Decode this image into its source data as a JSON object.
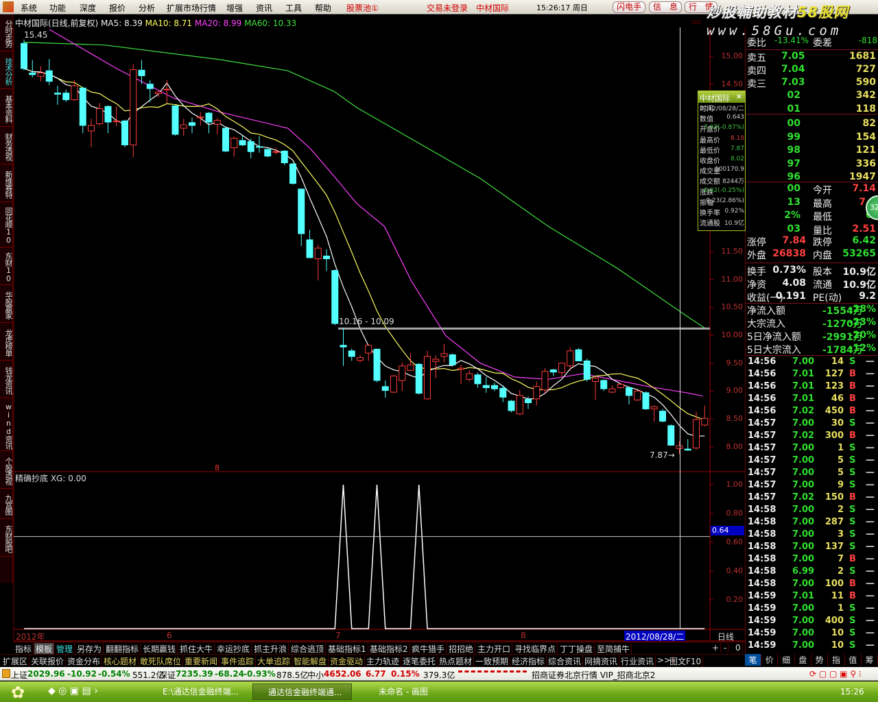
{
  "menu": {
    "items": [
      "系统",
      "功能",
      "深度",
      "报价",
      "分析",
      "扩展市场行情",
      "增强",
      "资讯",
      "工具",
      "帮助"
    ],
    "stock_pool": "股票池①",
    "trade_status": "交易未登录",
    "stock_name": "中材国际",
    "clock": "15:26:17 周日",
    "buttons": [
      "闪电手",
      "信　息",
      "行　情"
    ]
  },
  "watermark": {
    "line1a": "炒股輔助教材",
    "line1b": "58股网",
    "line2": "www.58Gu.com"
  },
  "sidebar": [
    "分时走势",
    "技术分析",
    "基本资料",
    "财务透视",
    "新维赛特",
    "同花顺10",
    "东财10",
    "华股赢家",
    "龙虎榜单",
    "钱龙资讯",
    "wind资讯",
    "个股透视",
    "九宫图",
    "东财股吧"
  ],
  "chart_header": {
    "title": "中材国际(日线,前复权)",
    "ma5": "MA5: 8.39",
    "ma10": "MA10: 8.71",
    "ma20": "MA20: 8.99",
    "ma60": "MA60: 10.33"
  },
  "annotations": {
    "high_label": "15.45",
    "range_label": "10.16 - 10.09",
    "low_label": "7.87",
    "marker_8": "8"
  },
  "indicator_header": "精确抄底 XG: 0.00",
  "colors": {
    "up": "#ff3c3c",
    "down": "#54ffff",
    "ma5": "#ffffff",
    "ma10": "#ffff60",
    "ma20": "#ff40ff",
    "ma60": "#40e040",
    "grid": "#700000"
  },
  "chart_data": {
    "type": "candlestick",
    "price_axis": {
      "ticks": [
        "15.00",
        "14.50",
        "11.50",
        "11.00",
        "10.50",
        "10.00",
        "9.50",
        "9.00",
        "8.50",
        "8.00"
      ],
      "range": [
        7.6,
        15.5
      ]
    },
    "indicator_axis": {
      "ticks": [
        "1.00",
        "0.80",
        "0.60",
        "0.40",
        "0.20"
      ],
      "cursor_value": "0.64",
      "range": [
        0,
        1.05
      ]
    },
    "date_labels": [
      "2012年",
      "6",
      "7",
      "8"
    ],
    "cursor_date": "2012/08/28/二",
    "period_label": "日线",
    "ohlc": [
      [
        15.23,
        15.3,
        14.75,
        14.78
      ],
      [
        14.7,
        14.93,
        14.62,
        14.67
      ],
      [
        14.64,
        14.82,
        14.55,
        14.7
      ],
      [
        14.74,
        14.95,
        14.48,
        14.55
      ],
      [
        14.34,
        14.47,
        14.13,
        14.32
      ],
      [
        14.34,
        14.4,
        14.18,
        14.22
      ],
      [
        14.22,
        14.57,
        14.2,
        14.47
      ],
      [
        14.43,
        14.45,
        13.62,
        13.76
      ],
      [
        13.66,
        13.88,
        13.37,
        13.76
      ],
      [
        13.79,
        14.16,
        13.76,
        14.06
      ],
      [
        14.1,
        14.12,
        13.62,
        13.82
      ],
      [
        13.83,
        14.1,
        13.75,
        13.84
      ],
      [
        13.84,
        13.86,
        13.37,
        13.41
      ],
      [
        13.41,
        14.86,
        13.19,
        14.76
      ],
      [
        14.75,
        14.93,
        14.5,
        14.65
      ],
      [
        14.5,
        14.57,
        14.18,
        14.42
      ],
      [
        14.33,
        14.38,
        14.27,
        14.36
      ],
      [
        14.41,
        14.57,
        14.16,
        14.41
      ],
      [
        14.11,
        14.12,
        13.58,
        13.6
      ],
      [
        13.71,
        13.88,
        13.57,
        13.77
      ],
      [
        13.81,
        13.9,
        13.62,
        13.76
      ],
      [
        13.91,
        14.0,
        13.76,
        13.91
      ],
      [
        13.98,
        14.0,
        13.62,
        13.82
      ],
      [
        13.78,
        13.89,
        13.6,
        13.85
      ],
      [
        13.71,
        13.73,
        13.28,
        13.3
      ],
      [
        13.36,
        13.56,
        13.2,
        13.53
      ],
      [
        13.49,
        13.57,
        13.39,
        13.41
      ],
      [
        13.47,
        13.52,
        13.17,
        13.29
      ],
      [
        13.38,
        13.57,
        13.27,
        13.37
      ],
      [
        13.33,
        13.35,
        13.19,
        13.21
      ],
      [
        13.29,
        13.36,
        13.24,
        13.29
      ],
      [
        13.3,
        13.32,
        13.05,
        13.09
      ],
      [
        13.07,
        13.09,
        12.7,
        12.72
      ],
      [
        12.62,
        12.63,
        11.6,
        11.82
      ],
      [
        11.71,
        11.89,
        11.38,
        11.39
      ],
      [
        11.37,
        11.62,
        10.98,
        11.56
      ],
      [
        11.42,
        11.54,
        11.15,
        11.37
      ],
      [
        11.16,
        11.18,
        10.18,
        10.21
      ],
      [
        9.82,
        10.13,
        9.45,
        9.79
      ],
      [
        9.72,
        9.76,
        9.54,
        9.62
      ],
      [
        9.55,
        9.64,
        9.51,
        9.6
      ],
      [
        9.68,
        9.84,
        9.54,
        9.82
      ],
      [
        9.75,
        9.76,
        9.16,
        9.19
      ],
      [
        9.08,
        9.19,
        8.88,
        9.01
      ],
      [
        8.98,
        9.29,
        8.96,
        9.27
      ],
      [
        9.19,
        9.51,
        9.0,
        9.45
      ],
      [
        9.37,
        9.68,
        9.36,
        9.47
      ],
      [
        9.48,
        9.5,
        8.94,
        8.96
      ],
      [
        8.86,
        9.72,
        8.84,
        9.62
      ],
      [
        9.53,
        9.64,
        9.23,
        9.57
      ],
      [
        9.62,
        9.84,
        9.51,
        9.67
      ],
      [
        9.65,
        9.67,
        9.44,
        9.47
      ],
      [
        9.39,
        9.47,
        9.13,
        9.41
      ],
      [
        9.21,
        9.37,
        9.17,
        9.31
      ],
      [
        9.29,
        9.33,
        9.06,
        9.13
      ],
      [
        9.1,
        9.25,
        8.97,
        9.06
      ],
      [
        9.1,
        9.15,
        9.0,
        9.04
      ],
      [
        9.05,
        9.1,
        8.8,
        8.89
      ],
      [
        8.82,
        8.84,
        8.62,
        8.65
      ],
      [
        8.59,
        9.02,
        8.57,
        8.92
      ],
      [
        8.85,
        8.9,
        8.68,
        8.79
      ],
      [
        8.86,
        9.17,
        8.74,
        9.08
      ],
      [
        9.02,
        9.41,
        8.96,
        9.35
      ],
      [
        9.38,
        9.4,
        9.27,
        9.34
      ],
      [
        9.33,
        9.51,
        9.25,
        9.5
      ],
      [
        9.45,
        9.78,
        9.37,
        9.72
      ],
      [
        9.74,
        9.77,
        9.53,
        9.54
      ],
      [
        9.54,
        9.58,
        9.17,
        9.21
      ],
      [
        9.17,
        9.25,
        8.84,
        9.23
      ],
      [
        9.19,
        9.21,
        9.0,
        9.04
      ],
      [
        8.98,
        9.1,
        8.96,
        9.04
      ],
      [
        9.06,
        9.15,
        9.04,
        9.12
      ],
      [
        9.06,
        9.08,
        8.76,
        8.92
      ],
      [
        8.84,
        9.02,
        8.82,
        9.0
      ],
      [
        8.97,
        8.99,
        8.66,
        8.68
      ],
      [
        8.68,
        8.74,
        8.45,
        8.72
      ],
      [
        8.64,
        8.68,
        8.44,
        8.46
      ],
      [
        8.38,
        8.4,
        8.02,
        8.03
      ],
      [
        7.97,
        8.1,
        7.87,
        8.02
      ],
      [
        7.96,
        8.14,
        7.93,
        7.94
      ],
      [
        7.98,
        8.63,
        7.95,
        8.49
      ],
      [
        8.39,
        8.74,
        8.37,
        8.51
      ]
    ],
    "ma20": [
      [
        3,
        15.48
      ],
      [
        11,
        14.78
      ],
      [
        17.8,
        14.25
      ],
      [
        23.3,
        14.0
      ],
      [
        31.4,
        13.71
      ],
      [
        34.1,
        13.34
      ],
      [
        36.9,
        12.85
      ],
      [
        39.6,
        12.36
      ],
      [
        42.9,
        11.95
      ],
      [
        46.1,
        10.97
      ],
      [
        50.2,
        9.99
      ],
      [
        54.3,
        9.5
      ],
      [
        58.4,
        9.25
      ],
      [
        62.4,
        9.21
      ],
      [
        66.5,
        9.31
      ],
      [
        70.6,
        9.19
      ],
      [
        74.7,
        9.07
      ],
      [
        78.8,
        8.97
      ],
      [
        80.8,
        8.91
      ]
    ],
    "ma60": [
      [
        0,
        15.25
      ],
      [
        9.6,
        15.2
      ],
      [
        23.3,
        14.94
      ],
      [
        31.4,
        14.74
      ],
      [
        36.9,
        14.37
      ],
      [
        39.6,
        14.08
      ],
      [
        54.3,
        12.81
      ],
      [
        62.4,
        11.95
      ],
      [
        70.6,
        11.2
      ],
      [
        78.8,
        10.35
      ],
      [
        81.2,
        10.11
      ]
    ],
    "signal_indices": [
      38,
      42,
      47
    ],
    "cursor_index": 78,
    "range_line_price": 10.12
  },
  "popup": {
    "title": "中材国际",
    "rows": [
      [
        "时间",
        "2012/08/28/二"
      ],
      [
        "数值",
        "0.643"
      ],
      [
        "开盘价",
        "7.97(-0.87%)"
      ],
      [
        "最高价",
        "8.10"
      ],
      [
        "最低价",
        "7.87"
      ],
      [
        "收盘价",
        "8.02"
      ],
      [
        "成交量",
        "100170.9"
      ],
      [
        "成交额",
        "8244万"
      ],
      [
        "涨跌",
        "-0.02(-0.25%)"
      ],
      [
        "振幅",
        "0.23(2.86%)"
      ],
      [
        "换手率",
        "0.92%"
      ],
      [
        "流通股",
        "10.9亿"
      ]
    ]
  },
  "quote": {
    "wei": {
      "label1": "委比",
      "v1": "-13.41%",
      "label2": "委差",
      "v2": "-818"
    },
    "asks": [
      [
        "卖五",
        "7.05",
        "1681"
      ],
      [
        "卖四",
        "7.04",
        "727"
      ],
      [
        "卖三",
        "7.03",
        "590"
      ]
    ],
    "hidden_rows": [
      [
        "02",
        "342"
      ],
      [
        "01",
        "118"
      ],
      [
        "00",
        "82"
      ],
      [
        "99",
        "154"
      ],
      [
        "98",
        "121"
      ],
      [
        "97",
        "336"
      ],
      [
        "96",
        "1947"
      ]
    ],
    "stats_partial": [
      [
        "00",
        "今开",
        "7.14"
      ],
      [
        "13",
        "最高",
        "7.1"
      ],
      [
        "2%",
        "最低",
        "6."
      ],
      [
        "03",
        "量比",
        "2.51"
      ]
    ],
    "badge": "32",
    "stats": [
      [
        "涨停",
        "7.84",
        "跌停",
        "6.42"
      ],
      [
        "外盘",
        "26838",
        "内盘",
        "53265"
      ],
      [
        "换手",
        "0.73%",
        "股本",
        "10.9亿"
      ],
      [
        "净资",
        "4.08",
        "流通",
        "10.9亿"
      ],
      [
        "收益(一)",
        "0.191",
        "PE(动)",
        "9.2"
      ]
    ],
    "flows": [
      [
        "净流入额",
        "-1554万",
        "-28%"
      ],
      [
        "大宗流入",
        "-1270万",
        "-23%"
      ],
      [
        "5日净流入额",
        "-2991万",
        "-20%"
      ],
      [
        "5日大宗流入",
        "-1784万",
        "-12%"
      ]
    ],
    "ticks": [
      [
        "14:56",
        "7.00",
        "14",
        "S"
      ],
      [
        "14:56",
        "7.01",
        "127",
        "B"
      ],
      [
        "14:56",
        "7.01",
        "123",
        "B"
      ],
      [
        "14:56",
        "7.01",
        "46",
        "B"
      ],
      [
        "14:56",
        "7.02",
        "450",
        "B"
      ],
      [
        "14:57",
        "7.00",
        "30",
        "S"
      ],
      [
        "14:57",
        "7.02",
        "300",
        "B"
      ],
      [
        "14:57",
        "7.00",
        "1",
        "S"
      ],
      [
        "14:57",
        "7.00",
        "5",
        "S"
      ],
      [
        "14:57",
        "7.00",
        "5",
        "S"
      ],
      [
        "14:57",
        "7.00",
        "9",
        "S"
      ],
      [
        "14:57",
        "7.02",
        "150",
        "B"
      ],
      [
        "14:58",
        "7.00",
        "2",
        "S"
      ],
      [
        "14:58",
        "7.00",
        "287",
        "S"
      ],
      [
        "14:58",
        "7.00",
        "3",
        "S"
      ],
      [
        "14:58",
        "7.00",
        "137",
        "S"
      ],
      [
        "14:58",
        "7.00",
        "7",
        "B"
      ],
      [
        "14:58",
        "6.99",
        "2",
        "S"
      ],
      [
        "14:58",
        "7.00",
        "100",
        "B"
      ],
      [
        "14:59",
        "7.01",
        "11",
        "B"
      ],
      [
        "14:59",
        "7.00",
        "1",
        "S"
      ],
      [
        "14:59",
        "7.00",
        "400",
        "S"
      ],
      [
        "14:59",
        "7.00",
        "10",
        "S"
      ],
      [
        "14:59",
        "7.00",
        "10",
        "S"
      ]
    ],
    "tabs": [
      "笔",
      "价",
      "细",
      "盘",
      "势",
      "指",
      "值",
      "筹"
    ]
  },
  "indicator_tabs": [
    "指标",
    "模板",
    "管理",
    "另存为",
    "翻翻指标",
    "长期赢钱",
    "抓住大牛",
    "幸运抄底",
    "抓主升浪",
    "综合逃顶",
    "基础指标1",
    "基础指标2",
    "疯牛猎手",
    "招招绝",
    "主力开口",
    "寻找临界点",
    "丁丁操盘",
    "至简捕牛"
  ],
  "zoom_buttons": [
    "+",
    "-",
    "0"
  ],
  "ext_tabs": [
    "扩展区",
    "关联报价",
    "资金分布",
    "核心题材",
    "敢死队席位",
    "重要新闻",
    "事件追踪",
    "大单追踪",
    "智能解盘",
    "资金驱动",
    "主力轨迹",
    "逐笔委托",
    "热点题材",
    "一致预期",
    "经济指标",
    "综合资讯",
    "网摘资讯",
    "行业资讯",
    ">>",
    "图文F10"
  ],
  "status": {
    "sh": "上证",
    "sh_val": "2029.96",
    "sh_chg": "-10.92",
    "sh_pct": "-0.54%",
    "sh_amt": "551.2亿",
    "sz": "深证",
    "sz_val": "7235.39",
    "sz_chg": "-68.24",
    "sz_pct": "-0.93%",
    "sz_amt": "878.5亿",
    "zx": "中小",
    "zx_val": "4652.06",
    "zx_chg": "6.77",
    "zx_pct": "0.15%",
    "zx_amt": "379.3亿",
    "server": "招商证券北京行情  VIP_招商北京2"
  },
  "taskbar": {
    "tasks": [
      "E:\\通达信金融终端...",
      "通达信金融终端通...",
      "未命名 - 画图"
    ],
    "clock": "15:26"
  }
}
